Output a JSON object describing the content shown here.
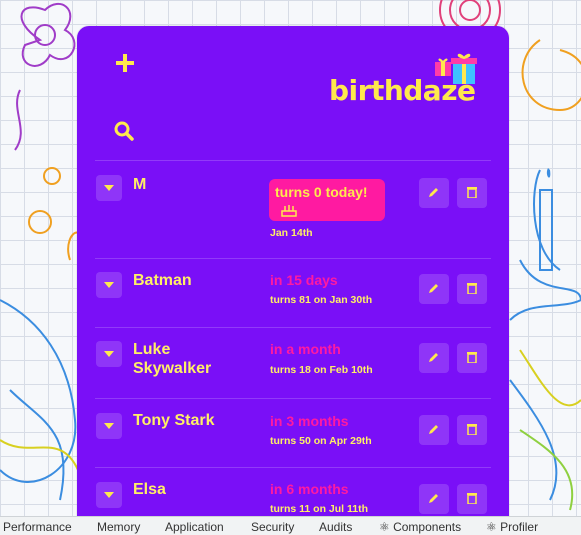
{
  "app": {
    "logo_text": "birthdaze",
    "accent_color": "#7a0ff7",
    "highlight_color": "#ff1aa1",
    "text_color": "#ffef66"
  },
  "toolbar": {
    "add_icon": "plus-icon",
    "search_icon": "search-icon"
  },
  "birthdays": [
    {
      "name": "M",
      "when": "turns 0 today!",
      "sub": "Jan 14th",
      "is_today": true
    },
    {
      "name": "Batman",
      "when": "in 15 days",
      "sub": "turns 81 on Jan 30th",
      "is_today": false
    },
    {
      "name": "Luke Skywalker",
      "when": "in a month",
      "sub": "turns 18 on Feb 10th",
      "is_today": false
    },
    {
      "name": "Tony Stark",
      "when": "in 3 months",
      "sub": "turns 50 on Apr 29th",
      "is_today": false
    },
    {
      "name": "Elsa",
      "when": "in 6 months",
      "sub": "turns 11 on Jul 11th",
      "is_today": false
    }
  ],
  "row_icons": {
    "expand": "chevron-down-icon",
    "edit": "pencil-icon",
    "delete": "trash-icon"
  },
  "devtools": {
    "tabs": [
      "Performance",
      "Memory",
      "Application",
      "Security",
      "Audits",
      "⚛ Components",
      "⚛ Profiler"
    ]
  }
}
